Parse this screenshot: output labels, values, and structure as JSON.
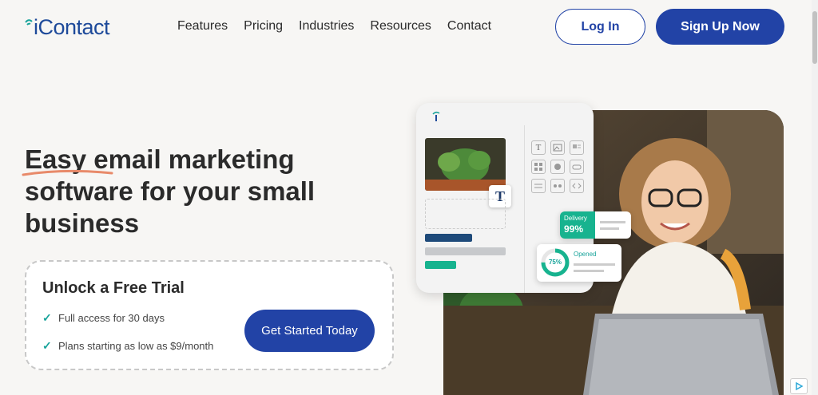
{
  "brand": {
    "name": "iContact",
    "accent": "#2243a6",
    "teal": "#17a39a"
  },
  "nav": {
    "items": [
      "Features",
      "Pricing",
      "Industries",
      "Resources",
      "Contact"
    ],
    "login_label": "Log In",
    "signup_label": "Sign Up Now"
  },
  "hero": {
    "title": "Easy email marketing software for your small business"
  },
  "trial": {
    "title": "Unlock a Free Trial",
    "items": [
      "Full access for 30 days",
      "Plans starting as low as $9/month"
    ],
    "cta_label": "Get Started Today"
  },
  "editor": {
    "text_block_glyph": "T"
  },
  "stats": {
    "delivery": {
      "label": "Delivery",
      "value": "99%"
    },
    "opened": {
      "label": "Opened",
      "value": "75%",
      "fraction": 0.75
    }
  }
}
